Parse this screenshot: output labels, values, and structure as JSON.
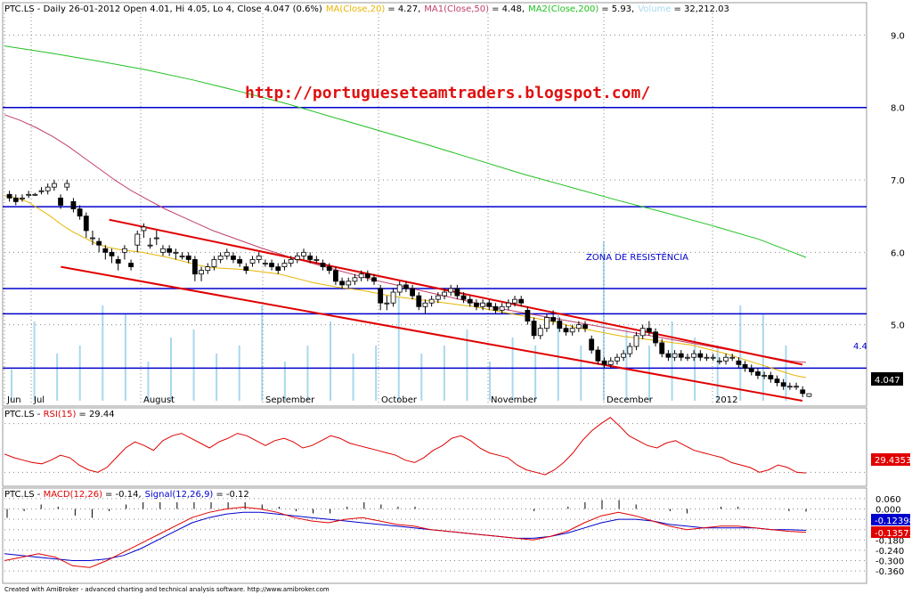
{
  "header": {
    "symbol": "PTC.LS",
    "main_text": "PTC.LS - Daily 26-01-2012 Open 4.01, Hi 4.05, Lo 4, Close 4.047 (0.6%)",
    "ma20_label": "MA(Close,20)",
    "ma20_value": "= 4.27,",
    "ma50_label": "MA1(Close,50)",
    "ma50_value": "= 4.48,",
    "ma200_label": "MA2(Close,200)",
    "ma200_value": "= 5.93,",
    "volume_label": "Volume",
    "volume_value": "= 32,212.03"
  },
  "url_text": "http://portugueseteamtraders.blogspot.com/",
  "annotation": "ZONA DE RESISTÊNCIA",
  "price_level_label": "4.4",
  "last_close_label": "4.047",
  "rsi_header": {
    "prefix": "PTC.LS - ",
    "label": "RSI(15)",
    "value": "= 29.44"
  },
  "rsi_current": "29.4353",
  "macd_header": {
    "prefix": "PTC.LS - ",
    "label": "MACD(12,26)",
    "value": "= -0.14,",
    "signal_label": "Signal(12,26,9)",
    "signal_value": "= -0.12"
  },
  "macd_current": "-0.13573",
  "signal_current": "-0.12398",
  "footer": "Created with AmiBroker - advanced charting and technical analysis software. http://www.amibroker.com",
  "colors": {
    "up": "#ffffff",
    "down": "#000000",
    "ma20": "#e8b400",
    "ma50": "#c0406a",
    "ma200": "#20c020",
    "volume": "#a8d8ee",
    "hline": "#0000cc",
    "channel": "#e00000",
    "rsi": "#e00000",
    "macd": "#e00000",
    "signal": "#0000cc"
  },
  "chart_data": [
    {
      "type": "candlestick",
      "name": "PTC.LS Daily",
      "x_labels": [
        "Jun",
        "Jul",
        "August",
        "September",
        "October",
        "November",
        "December",
        "2012"
      ],
      "y_ticks": [
        5.0,
        6.0,
        7.0,
        8.0,
        9.0
      ],
      "ylim": [
        3.95,
        9.3
      ],
      "ohlc": [
        [
          6.8,
          6.85,
          6.7,
          6.75
        ],
        [
          6.75,
          6.8,
          6.65,
          6.7
        ],
        [
          6.75,
          6.8,
          6.7,
          6.75
        ],
        [
          6.8,
          6.85,
          6.75,
          6.8
        ],
        [
          6.8,
          6.82,
          6.78,
          6.8
        ],
        [
          6.85,
          6.9,
          6.8,
          6.85
        ],
        [
          6.85,
          6.95,
          6.8,
          6.9
        ],
        [
          6.9,
          7.0,
          6.85,
          6.95
        ],
        [
          6.75,
          6.8,
          6.6,
          6.65
        ],
        [
          6.9,
          7.0,
          6.85,
          6.95
        ],
        [
          6.7,
          6.75,
          6.55,
          6.6
        ],
        [
          6.6,
          6.65,
          6.45,
          6.5
        ],
        [
          6.5,
          6.55,
          6.2,
          6.3
        ],
        [
          6.2,
          6.3,
          6.1,
          6.2
        ],
        [
          6.15,
          6.2,
          6.0,
          6.1
        ],
        [
          6.05,
          6.1,
          5.9,
          6.0
        ],
        [
          6.0,
          6.05,
          5.85,
          5.95
        ],
        [
          5.9,
          5.95,
          5.75,
          5.85
        ],
        [
          6.0,
          6.1,
          5.9,
          6.05
        ],
        [
          5.85,
          5.9,
          5.75,
          5.8
        ],
        [
          6.1,
          6.3,
          6.0,
          6.25
        ],
        [
          6.3,
          6.4,
          6.2,
          6.35
        ],
        [
          6.1,
          6.2,
          6.05,
          6.1
        ],
        [
          6.2,
          6.3,
          6.1,
          6.2
        ],
        [
          6.0,
          6.1,
          5.95,
          6.05
        ],
        [
          6.05,
          6.1,
          5.95,
          6.0
        ],
        [
          6.0,
          6.05,
          5.9,
          6.0
        ],
        [
          5.95,
          6.0,
          5.9,
          5.95
        ],
        [
          5.95,
          6.0,
          5.85,
          5.9
        ],
        [
          5.9,
          5.95,
          5.6,
          5.7
        ],
        [
          5.7,
          5.8,
          5.6,
          5.75
        ],
        [
          5.75,
          5.85,
          5.7,
          5.8
        ],
        [
          5.8,
          5.95,
          5.75,
          5.9
        ],
        [
          5.9,
          6.0,
          5.85,
          5.95
        ],
        [
          5.95,
          6.05,
          5.9,
          6.0
        ],
        [
          5.95,
          6.0,
          5.85,
          5.9
        ],
        [
          5.9,
          5.95,
          5.8,
          5.85
        ],
        [
          5.8,
          5.85,
          5.7,
          5.75
        ],
        [
          5.85,
          5.95,
          5.8,
          5.9
        ],
        [
          5.9,
          6.0,
          5.85,
          5.95
        ],
        [
          5.85,
          5.9,
          5.8,
          5.85
        ],
        [
          5.85,
          5.9,
          5.75,
          5.8
        ],
        [
          5.8,
          5.85,
          5.7,
          5.75
        ],
        [
          5.8,
          5.9,
          5.75,
          5.85
        ],
        [
          5.85,
          5.95,
          5.8,
          5.9
        ],
        [
          5.9,
          6.0,
          5.85,
          5.95
        ],
        [
          5.95,
          6.05,
          5.9,
          6.0
        ],
        [
          5.95,
          6.0,
          5.85,
          5.9
        ],
        [
          5.9,
          5.95,
          5.85,
          5.9
        ],
        [
          5.85,
          5.9,
          5.75,
          5.8
        ],
        [
          5.8,
          5.85,
          5.7,
          5.75
        ],
        [
          5.75,
          5.8,
          5.55,
          5.6
        ],
        [
          5.6,
          5.65,
          5.5,
          5.55
        ],
        [
          5.55,
          5.65,
          5.5,
          5.6
        ],
        [
          5.6,
          5.7,
          5.55,
          5.65
        ],
        [
          5.65,
          5.75,
          5.6,
          5.7
        ],
        [
          5.7,
          5.75,
          5.6,
          5.65
        ],
        [
          5.65,
          5.7,
          5.55,
          5.6
        ],
        [
          5.5,
          5.55,
          5.2,
          5.3
        ],
        [
          5.3,
          5.4,
          5.2,
          5.3
        ],
        [
          5.3,
          5.5,
          5.25,
          5.45
        ],
        [
          5.45,
          5.6,
          5.4,
          5.55
        ],
        [
          5.55,
          5.6,
          5.45,
          5.5
        ],
        [
          5.5,
          5.55,
          5.35,
          5.4
        ],
        [
          5.4,
          5.45,
          5.2,
          5.25
        ],
        [
          5.25,
          5.35,
          5.15,
          5.3
        ],
        [
          5.3,
          5.4,
          5.25,
          5.35
        ],
        [
          5.35,
          5.45,
          5.3,
          5.4
        ],
        [
          5.4,
          5.5,
          5.35,
          5.45
        ],
        [
          5.45,
          5.55,
          5.4,
          5.5
        ],
        [
          5.5,
          5.55,
          5.35,
          5.4
        ],
        [
          5.4,
          5.45,
          5.3,
          5.35
        ],
        [
          5.35,
          5.4,
          5.25,
          5.3
        ],
        [
          5.3,
          5.35,
          5.2,
          5.25
        ],
        [
          5.25,
          5.35,
          5.2,
          5.3
        ],
        [
          5.3,
          5.35,
          5.2,
          5.25
        ],
        [
          5.25,
          5.3,
          5.15,
          5.2
        ],
        [
          5.2,
          5.3,
          5.15,
          5.25
        ],
        [
          5.25,
          5.35,
          5.2,
          5.3
        ],
        [
          5.3,
          5.4,
          5.25,
          5.35
        ],
        [
          5.35,
          5.4,
          5.25,
          5.3
        ],
        [
          5.2,
          5.25,
          5.0,
          5.05
        ],
        [
          5.05,
          5.1,
          4.8,
          4.85
        ],
        [
          4.85,
          5.0,
          4.8,
          4.95
        ],
        [
          4.95,
          5.15,
          4.9,
          5.1
        ],
        [
          5.1,
          5.2,
          5.0,
          5.05
        ],
        [
          5.05,
          5.1,
          4.9,
          4.95
        ],
        [
          4.95,
          5.0,
          4.85,
          4.9
        ],
        [
          4.9,
          5.0,
          4.85,
          4.95
        ],
        [
          4.95,
          5.05,
          4.9,
          5.0
        ],
        [
          5.0,
          5.05,
          4.9,
          4.95
        ],
        [
          4.8,
          4.85,
          4.6,
          4.65
        ],
        [
          4.65,
          4.7,
          4.45,
          4.5
        ],
        [
          4.5,
          4.55,
          4.4,
          4.45
        ],
        [
          4.45,
          4.55,
          4.4,
          4.5
        ],
        [
          4.5,
          4.6,
          4.45,
          4.55
        ],
        [
          4.55,
          4.65,
          4.5,
          4.6
        ],
        [
          4.6,
          4.75,
          4.55,
          4.7
        ],
        [
          4.7,
          4.9,
          4.65,
          4.85
        ],
        [
          4.85,
          5.0,
          4.8,
          4.95
        ],
        [
          4.95,
          5.05,
          4.85,
          4.9
        ],
        [
          4.9,
          4.95,
          4.7,
          4.75
        ],
        [
          4.75,
          4.8,
          4.55,
          4.6
        ],
        [
          4.6,
          4.65,
          4.5,
          4.55
        ],
        [
          4.55,
          4.65,
          4.5,
          4.6
        ],
        [
          4.6,
          4.65,
          4.5,
          4.55
        ],
        [
          4.55,
          4.6,
          4.5,
          4.55
        ],
        [
          4.55,
          4.65,
          4.5,
          4.6
        ],
        [
          4.6,
          4.65,
          4.5,
          4.55
        ],
        [
          4.55,
          4.6,
          4.5,
          4.55
        ],
        [
          4.55,
          4.6,
          4.5,
          4.55
        ],
        [
          4.5,
          4.55,
          4.45,
          4.5
        ],
        [
          4.5,
          4.6,
          4.45,
          4.55
        ],
        [
          4.55,
          4.6,
          4.5,
          4.55
        ],
        [
          4.5,
          4.55,
          4.4,
          4.45
        ],
        [
          4.45,
          4.5,
          4.35,
          4.4
        ],
        [
          4.4,
          4.45,
          4.3,
          4.35
        ],
        [
          4.35,
          4.4,
          4.25,
          4.3
        ],
        [
          4.3,
          4.35,
          4.25,
          4.3
        ],
        [
          4.3,
          4.35,
          4.2,
          4.25
        ],
        [
          4.25,
          4.3,
          4.15,
          4.2
        ],
        [
          4.2,
          4.25,
          4.1,
          4.15
        ],
        [
          4.15,
          4.2,
          4.1,
          4.15
        ],
        [
          4.15,
          4.2,
          4.1,
          4.15
        ],
        [
          4.1,
          4.15,
          4.0,
          4.05
        ],
        [
          4.01,
          4.05,
          4.0,
          4.047
        ]
      ],
      "ma20": [
        6.78,
        6.75,
        6.7,
        6.6,
        6.5,
        6.38,
        6.28,
        6.2,
        6.12,
        6.07,
        6.04,
        6.02,
        6.0,
        5.97,
        5.94,
        5.9,
        5.86,
        5.82,
        5.79,
        5.78,
        5.77,
        5.76,
        5.74,
        5.72,
        5.7,
        5.66,
        5.62,
        5.58,
        5.55,
        5.52,
        5.5,
        5.48,
        5.45,
        5.42,
        5.39,
        5.37,
        5.35,
        5.33,
        5.31,
        5.29,
        5.27,
        5.25,
        5.22,
        5.19,
        5.16,
        5.13,
        5.1,
        5.07,
        5.04,
        5.0,
        4.96,
        4.93,
        4.9,
        4.87,
        4.84,
        4.82,
        4.8,
        4.78,
        4.76,
        4.74,
        4.72,
        4.68,
        4.64,
        4.6,
        4.55,
        4.5,
        4.45,
        4.4,
        4.35,
        4.3,
        4.27
      ],
      "ma50": [
        7.9,
        7.82,
        7.72,
        7.6,
        7.46,
        7.3,
        7.14,
        6.98,
        6.84,
        6.72,
        6.6,
        6.5,
        6.4,
        6.3,
        6.22,
        6.14,
        6.06,
        5.99,
        5.92,
        5.86,
        5.8,
        5.74,
        5.68,
        5.62,
        5.57,
        5.52,
        5.47,
        5.42,
        5.37,
        5.32,
        5.27,
        5.22,
        5.18,
        5.14,
        5.1,
        5.06,
        5.02,
        4.98,
        4.94,
        4.9,
        4.86,
        4.82,
        4.78,
        4.74,
        4.7,
        4.66,
        4.62,
        4.58,
        4.54,
        4.5,
        4.48
      ],
      "ma200": [
        8.85,
        8.75,
        8.64,
        8.52,
        8.38,
        8.22,
        8.05,
        7.86,
        7.67,
        7.48,
        7.28,
        7.08,
        6.9,
        6.72,
        6.55,
        6.37,
        6.18,
        5.93
      ],
      "volume_peaks": [
        0.15,
        0.45,
        0.25,
        0.3,
        0.55,
        0.5,
        0.2,
        0.35,
        0.4,
        0.25,
        0.3,
        0.55,
        0.2,
        0.3,
        0.45,
        0.25,
        0.3,
        0.6,
        0.25,
        0.3,
        0.4,
        0.2,
        0.35,
        0.3,
        0.5,
        0.3,
        0.95,
        0.4,
        0.3,
        0.45,
        0.35,
        0.3,
        0.55,
        0.5,
        0.3
      ],
      "horizontal_lines": [
        8.0,
        6.63,
        5.5,
        5.15,
        4.4
      ],
      "channel_upper": {
        "start": [
          0.13,
          6.45
        ],
        "end": [
          0.99,
          4.45
        ]
      },
      "channel_lower": {
        "start": [
          0.07,
          5.8
        ],
        "end": [
          0.99,
          3.95
        ]
      }
    },
    {
      "type": "line",
      "name": "RSI(15)",
      "ylim": [
        20,
        80
      ],
      "values": [
        45,
        42,
        40,
        38,
        37,
        40,
        44,
        42,
        36,
        32,
        30,
        34,
        42,
        50,
        55,
        52,
        48,
        56,
        60,
        62,
        58,
        54,
        50,
        55,
        58,
        62,
        60,
        56,
        52,
        56,
        58,
        55,
        50,
        52,
        56,
        60,
        58,
        54,
        52,
        50,
        48,
        46,
        44,
        40,
        38,
        42,
        48,
        52,
        58,
        60,
        56,
        50,
        46,
        44,
        42,
        36,
        32,
        30,
        28,
        32,
        38,
        46,
        56,
        64,
        70,
        75,
        68,
        60,
        56,
        52,
        50,
        54,
        56,
        52,
        48,
        46,
        44,
        42,
        38,
        36,
        34,
        30,
        32,
        36,
        34,
        30,
        29.44
      ]
    },
    {
      "type": "line",
      "name": "MACD(12,26)",
      "y_ticks": [
        0.06,
        0.0,
        -0.06,
        -0.12,
        -0.18,
        -0.24,
        -0.3,
        -0.36
      ],
      "series": [
        {
          "name": "MACD(12,26)",
          "values": [
            -0.3,
            -0.28,
            -0.26,
            -0.28,
            -0.33,
            -0.34,
            -0.3,
            -0.25,
            -0.2,
            -0.15,
            -0.1,
            -0.05,
            -0.02,
            0.0,
            0.01,
            0.0,
            -0.02,
            -0.05,
            -0.07,
            -0.08,
            -0.06,
            -0.05,
            -0.07,
            -0.09,
            -0.1,
            -0.12,
            -0.13,
            -0.14,
            -0.15,
            -0.16,
            -0.17,
            -0.18,
            -0.16,
            -0.13,
            -0.08,
            -0.04,
            -0.02,
            -0.04,
            -0.07,
            -0.1,
            -0.12,
            -0.11,
            -0.1,
            -0.1,
            -0.11,
            -0.12,
            -0.13,
            -0.136
          ]
        },
        {
          "name": "Signal(12,26,9)",
          "values": [
            -0.26,
            -0.27,
            -0.28,
            -0.29,
            -0.3,
            -0.3,
            -0.29,
            -0.27,
            -0.23,
            -0.18,
            -0.13,
            -0.08,
            -0.05,
            -0.03,
            -0.02,
            -0.02,
            -0.03,
            -0.04,
            -0.05,
            -0.06,
            -0.07,
            -0.08,
            -0.09,
            -0.1,
            -0.11,
            -0.12,
            -0.13,
            -0.14,
            -0.15,
            -0.16,
            -0.17,
            -0.17,
            -0.16,
            -0.14,
            -0.11,
            -0.08,
            -0.06,
            -0.06,
            -0.07,
            -0.09,
            -0.1,
            -0.11,
            -0.11,
            -0.11,
            -0.11,
            -0.12,
            -0.12,
            -0.124
          ]
        }
      ]
    }
  ]
}
